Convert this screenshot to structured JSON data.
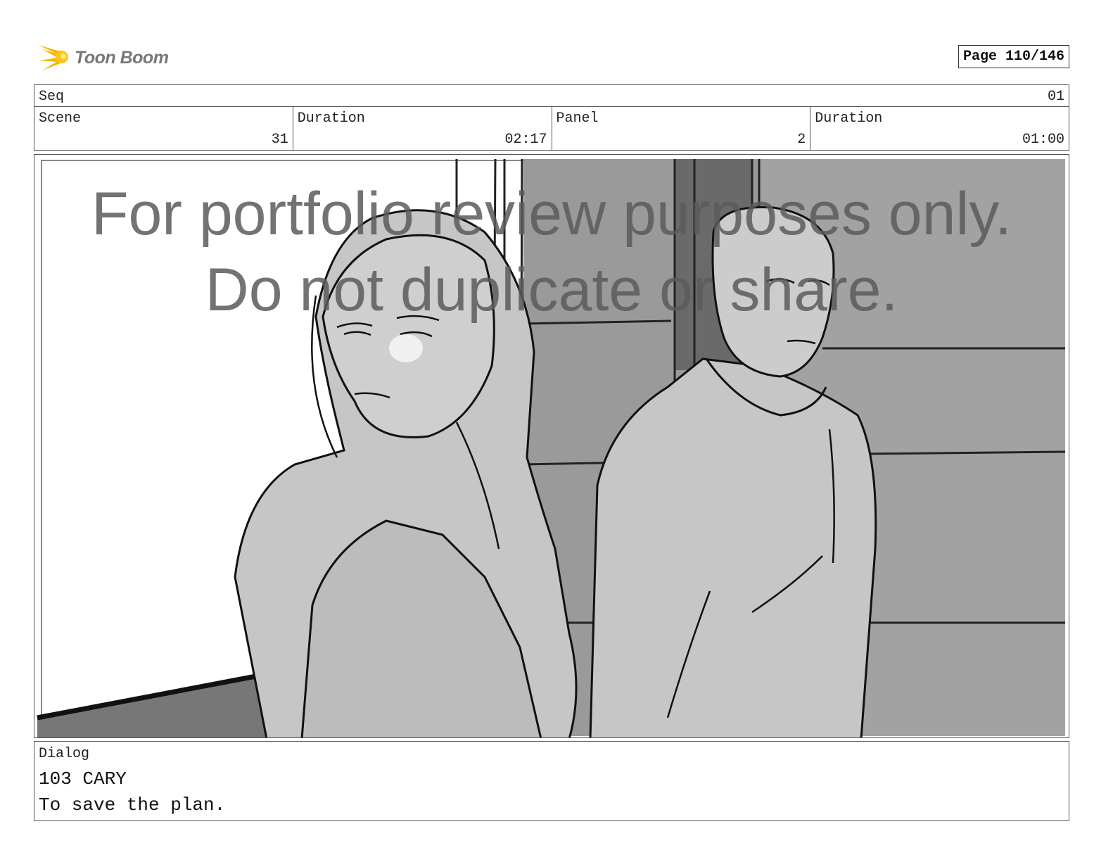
{
  "logo": {
    "text": "Toon Boom",
    "icon": "starburst-logo-icon",
    "color": "#f5b800"
  },
  "page_indicator": "Page 110/146",
  "header": {
    "seq_label": "Seq",
    "seq_value": "01",
    "scene_label": "Scene",
    "scene_value": "31",
    "scene_duration_label": "Duration",
    "scene_duration_value": "02:17",
    "panel_label": "Panel",
    "panel_value": "2",
    "panel_duration_label": "Duration",
    "panel_duration_value": "01:00"
  },
  "watermark": {
    "line1": "For portfolio review purposes only.",
    "line2": "Do not duplicate or share."
  },
  "dialog": {
    "label": "Dialog",
    "line1": "103 CARY",
    "line2": "To save the plan."
  }
}
